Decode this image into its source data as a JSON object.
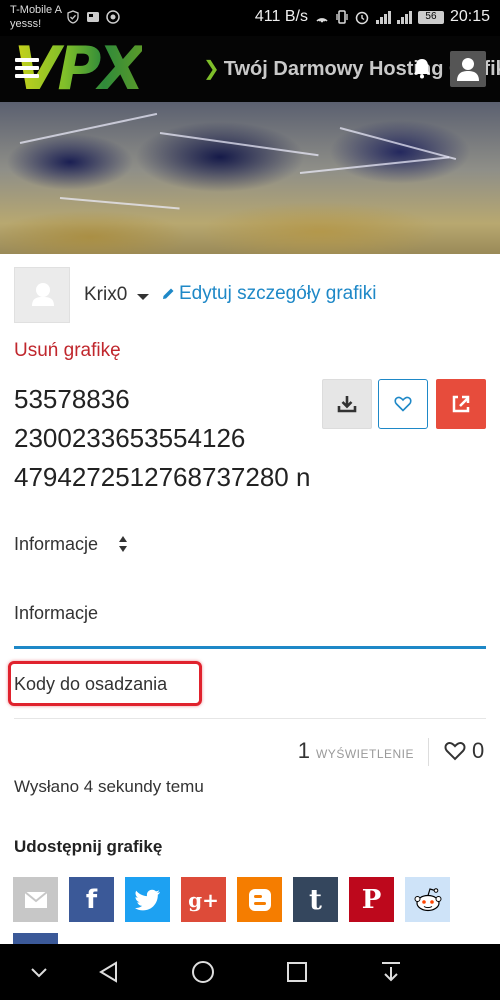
{
  "status_bar": {
    "carrier_line1": "T-Mobile A",
    "carrier_line2": "yesss!",
    "network_speed": "411 B/s",
    "battery_level": "56",
    "time": "20:15"
  },
  "header": {
    "logo_text": "VPX",
    "tagline": "Twój Darmowy Hosting Grafik",
    "icons": [
      "menu-icon",
      "bell-icon",
      "user-icon"
    ]
  },
  "author": {
    "name": "Krix0",
    "edit_label": "Edytuj szczegóły grafiki"
  },
  "image": {
    "delete_label": "Usuń grafikę",
    "title_lines": [
      "53578836",
      "2300233653554126",
      "4794272512768737280 n"
    ]
  },
  "tabs": {
    "selector_label": "Informacje",
    "items": [
      "Informacje",
      "Kody do osadzania"
    ],
    "active": "Informacje"
  },
  "stats": {
    "views_count": "1",
    "views_label": "WYŚWIETLENIE",
    "likes_count": "0"
  },
  "uploaded_text": "Wysłano 4 sekundy temu",
  "share": {
    "title": "Udostępnij grafikę",
    "buttons": [
      {
        "name": "email",
        "label": "",
        "color": "#c7c7c7"
      },
      {
        "name": "facebook",
        "label": "f",
        "color": "#3b5998"
      },
      {
        "name": "twitter",
        "label": "",
        "color": "#1da1f2"
      },
      {
        "name": "google-plus",
        "label": "g+",
        "color": "#dd4b39"
      },
      {
        "name": "blogger",
        "label": "B",
        "color": "#f57d00"
      },
      {
        "name": "tumblr",
        "label": "t",
        "color": "#34465d"
      },
      {
        "name": "pinterest",
        "label": "P",
        "color": "#bd081c"
      },
      {
        "name": "reddit",
        "label": "",
        "color": "#cee3f8"
      }
    ]
  },
  "colors": {
    "link_blue": "#1e88c7",
    "delete_red": "#c0272d",
    "share_red": "#e74c3c",
    "highlight_red": "#e0222d"
  }
}
